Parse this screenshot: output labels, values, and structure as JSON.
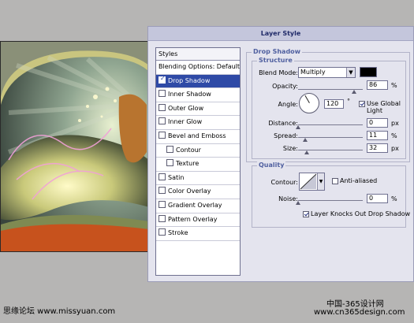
{
  "dialog": {
    "title": "Layer Style",
    "styles_header": "Styles",
    "style_items": [
      {
        "label": "Blending Options: Default",
        "checkbox": false,
        "checked": false,
        "selected": false,
        "indent": false
      },
      {
        "label": "Drop Shadow",
        "checkbox": true,
        "checked": true,
        "selected": true,
        "indent": false
      },
      {
        "label": "Inner Shadow",
        "checkbox": true,
        "checked": false,
        "selected": false,
        "indent": false
      },
      {
        "label": "Outer Glow",
        "checkbox": true,
        "checked": false,
        "selected": false,
        "indent": false
      },
      {
        "label": "Inner Glow",
        "checkbox": true,
        "checked": false,
        "selected": false,
        "indent": false
      },
      {
        "label": "Bevel and Emboss",
        "checkbox": true,
        "checked": false,
        "selected": false,
        "indent": false
      },
      {
        "label": "Contour",
        "checkbox": true,
        "checked": false,
        "selected": false,
        "indent": true
      },
      {
        "label": "Texture",
        "checkbox": true,
        "checked": false,
        "selected": false,
        "indent": true
      },
      {
        "label": "Satin",
        "checkbox": true,
        "checked": false,
        "selected": false,
        "indent": false
      },
      {
        "label": "Color Overlay",
        "checkbox": true,
        "checked": false,
        "selected": false,
        "indent": false
      },
      {
        "label": "Gradient Overlay",
        "checkbox": true,
        "checked": false,
        "selected": false,
        "indent": false
      },
      {
        "label": "Pattern Overlay",
        "checkbox": true,
        "checked": false,
        "selected": false,
        "indent": false
      },
      {
        "label": "Stroke",
        "checkbox": true,
        "checked": false,
        "selected": false,
        "indent": false
      }
    ],
    "drop_shadow": {
      "section_title": "Drop Shadow",
      "structure_title": "Structure",
      "blend_mode_label": "Blend Mode:",
      "blend_mode_value": "Multiply",
      "shadow_color": "#000000",
      "opacity_label": "Opacity:",
      "opacity_value": "86",
      "opacity_percent": 86,
      "angle_label": "Angle:",
      "angle_value": "120",
      "angle_degrees": 120,
      "degree_symbol": "°",
      "use_global_light_label": "Use Global Light",
      "use_global_light": true,
      "distance_label": "Distance:",
      "distance_value": "0",
      "distance_fraction": 0.0,
      "spread_label": "Spread:",
      "spread_value": "11",
      "spread_fraction": 0.11,
      "size_label": "Size:",
      "size_value": "32",
      "size_fraction": 0.13,
      "px_unit": "px",
      "percent_unit": "%",
      "quality_title": "Quality",
      "contour_label": "Contour:",
      "anti_aliased_label": "Anti-aliased",
      "anti_aliased": false,
      "noise_label": "Noise:",
      "noise_value": "0",
      "noise_fraction": 0.0,
      "knockout_label": "Layer Knocks Out Drop Shadow",
      "knockout": true
    }
  },
  "watermarks": {
    "left": "思缘论坛 www.missyuan.com",
    "right_top": "中国-365设计网",
    "right_bottom": "www.cn365design.com"
  },
  "colors": {
    "selection": "#2f4aa6",
    "dialog_bg": "#e4e4ee",
    "accent_text": "#202a68"
  }
}
